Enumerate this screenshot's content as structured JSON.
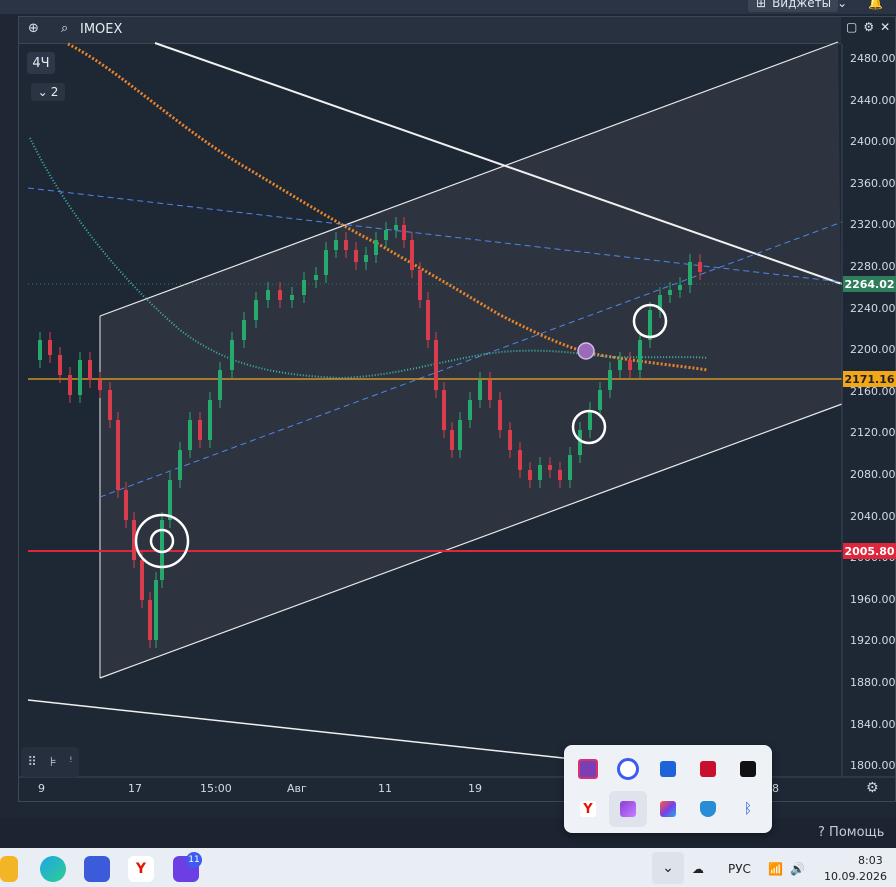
{
  "header": {
    "widgets_label": "Виджеты"
  },
  "toolbar": {
    "symbol": "IMOEX",
    "timeframe": "4Ч",
    "indicators_count": "2"
  },
  "price_axis": {
    "ticks": [
      "2480.00",
      "2440.00",
      "2400.00",
      "2360.00",
      "2320.00",
      "2280.00",
      "2240.00",
      "2200.00",
      "2160.00",
      "2120.00",
      "2080.00",
      "2040.00",
      "2000.00",
      "1960.00",
      "1920.00",
      "1880.00",
      "1840.00",
      "1800.00"
    ],
    "current_price": "2264.02",
    "level_mid": "2171.16",
    "level_low": "2005.80",
    "colors": {
      "current": "#2e7d5b",
      "mid": "#f2a71b",
      "low": "#e0263d"
    }
  },
  "time_axis": {
    "ticks": [
      "9",
      "17",
      "15:00",
      "Авг",
      "11",
      "19",
      "18"
    ]
  },
  "footer": {
    "help_label": "Помощь"
  },
  "tray": {
    "icons": [
      "camera-app-icon",
      "ring-app-icon",
      "remote-desktop-icon",
      "amd-icon",
      "capcut-icon",
      "yandex-icon",
      "pen-app-icon",
      "office-app-icon",
      "defender-icon",
      "bluetooth-icon"
    ]
  },
  "taskbar": {
    "yandex_badge": "11",
    "language": "РУС",
    "time": "8:03",
    "date": "10.09.2026"
  }
}
